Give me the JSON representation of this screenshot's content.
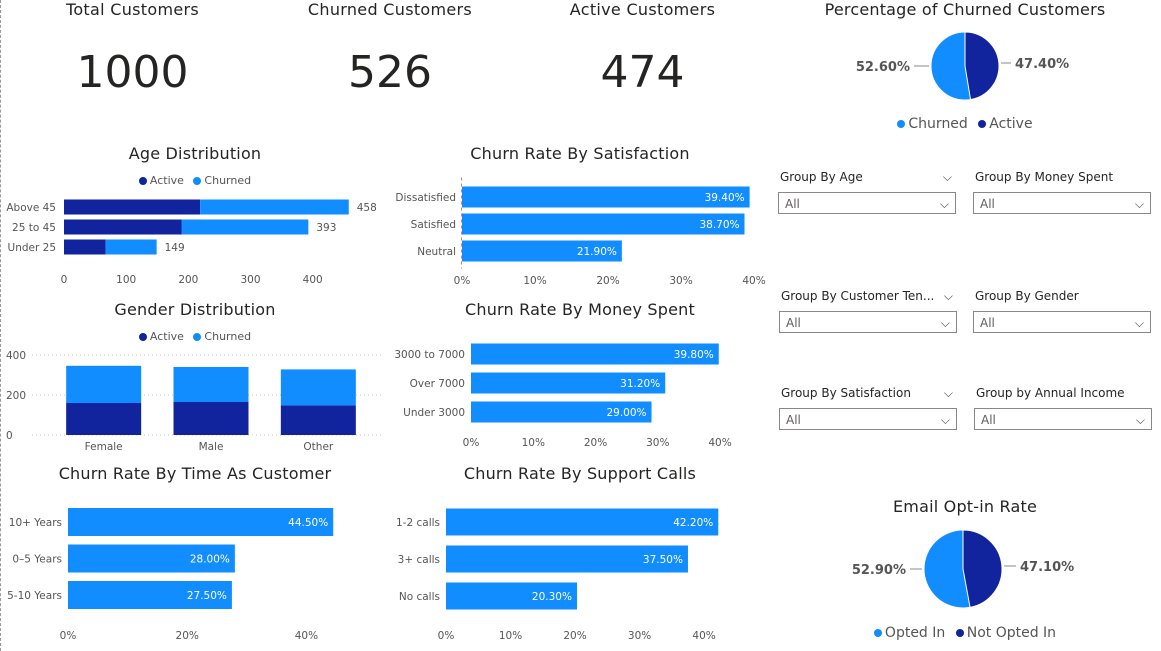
{
  "kpis": {
    "total": {
      "title": "Total Customers",
      "value": "1000"
    },
    "churned": {
      "title": "Churned Customers",
      "value": "526"
    },
    "active": {
      "title": "Active Customers",
      "value": "474"
    }
  },
  "colors": {
    "active": "#12239E",
    "churned": "#118DFF"
  },
  "slicers": [
    {
      "title": "Group By Age",
      "value": "All"
    },
    {
      "title": "Group By Money Spent",
      "value": "All"
    },
    {
      "title": "Group By Customer Ten...",
      "value": "All"
    },
    {
      "title": "Group By Gender",
      "value": "All"
    },
    {
      "title": "Group By Satisfaction",
      "value": "All"
    },
    {
      "title": "Group by Annual Income",
      "value": "All"
    }
  ],
  "icons": {
    "dropdown": "chevron-down-icon"
  },
  "chart_data": [
    {
      "id": "churn_pie",
      "type": "pie",
      "title": "Percentage of Churned Customers",
      "categories": [
        "Churned",
        "Active"
      ],
      "values": [
        52.6,
        47.4
      ],
      "labels": [
        "52.60%",
        "47.40%"
      ],
      "legend": [
        "Churned",
        "Active"
      ],
      "legend_position": "bottom"
    },
    {
      "id": "age",
      "type": "bar",
      "orientation": "horizontal",
      "stacked": true,
      "title": "Age Distribution",
      "legend": [
        "Active",
        "Churned"
      ],
      "legend_position": "top",
      "categories": [
        "Above 45",
        "25 to 45",
        "Under 25"
      ],
      "series": [
        {
          "name": "Active",
          "values": [
            219,
            189,
            67
          ]
        },
        {
          "name": "Churned",
          "values": [
            239,
            204,
            82
          ]
        }
      ],
      "totals": [
        "458",
        "393",
        "149"
      ],
      "xlim": [
        0,
        460
      ],
      "xticks": [
        "0",
        "100",
        "200",
        "300",
        "400"
      ],
      "xtick_values": [
        0,
        100,
        200,
        300,
        400
      ]
    },
    {
      "id": "gender",
      "type": "bar",
      "orientation": "vertical",
      "stacked": true,
      "title": "Gender Distribution",
      "legend": [
        "Active",
        "Churned"
      ],
      "legend_position": "top",
      "categories": [
        "Female",
        "Male",
        "Other"
      ],
      "series": [
        {
          "name": "Active",
          "values": [
            160,
            165,
            148
          ]
        },
        {
          "name": "Churned",
          "values": [
            186,
            175,
            180
          ]
        }
      ],
      "ylim": [
        0,
        420
      ],
      "yticks": [
        "0",
        "200",
        "400"
      ],
      "ytick_values": [
        0,
        200,
        400
      ],
      "grid": true
    },
    {
      "id": "time",
      "type": "bar",
      "orientation": "horizontal",
      "title": "Churn Rate By Time As Customer",
      "categories": [
        "10+ Years",
        "0–5 Years",
        "5-10 Years"
      ],
      "values": [
        44.5,
        28.0,
        27.5
      ],
      "labels": [
        "44.50%",
        "28.00%",
        "27.50%"
      ],
      "xlim": [
        0,
        50
      ],
      "xticks": [
        "0%",
        "20%",
        "40%"
      ],
      "xtick_values": [
        0,
        20,
        40
      ]
    },
    {
      "id": "satisfaction",
      "type": "bar",
      "orientation": "horizontal",
      "title": "Churn Rate By Satisfaction",
      "categories": [
        "Dissatisfied",
        "Satisfied",
        "Neutral"
      ],
      "values": [
        39.4,
        38.7,
        21.9
      ],
      "labels": [
        "39.40%",
        "38.70%",
        "21.90%"
      ],
      "xlim": [
        0,
        40
      ],
      "xticks": [
        "0%",
        "10%",
        "20%",
        "30%",
        "40%"
      ],
      "xtick_values": [
        0,
        10,
        20,
        30,
        40
      ]
    },
    {
      "id": "money",
      "type": "bar",
      "orientation": "horizontal",
      "title": "Churn Rate By Money Spent",
      "categories": [
        "3000 to 7000",
        "Over 7000",
        "Under 3000"
      ],
      "values": [
        39.8,
        31.2,
        29.0
      ],
      "labels": [
        "39.80%",
        "31.20%",
        "29.00%"
      ],
      "xlim": [
        0,
        40
      ],
      "xticks": [
        "0%",
        "10%",
        "20%",
        "30%",
        "40%"
      ],
      "xtick_values": [
        0,
        10,
        20,
        30,
        40
      ]
    },
    {
      "id": "support",
      "type": "bar",
      "orientation": "horizontal",
      "title": "Churn Rate By Support Calls",
      "categories": [
        "1-2 calls",
        "3+ calls",
        "No calls"
      ],
      "values": [
        42.2,
        37.5,
        20.3
      ],
      "labels": [
        "42.20%",
        "37.50%",
        "20.30%"
      ],
      "xlim": [
        0,
        42
      ],
      "xticks": [
        "0%",
        "10%",
        "20%",
        "30%",
        "40%"
      ],
      "xtick_values": [
        0,
        10,
        20,
        30,
        40
      ]
    },
    {
      "id": "email_pie",
      "type": "pie",
      "title": "Email Opt-in Rate",
      "categories": [
        "Opted In",
        "Not Opted In"
      ],
      "values": [
        52.9,
        47.1
      ],
      "labels": [
        "52.90%",
        "47.10%"
      ],
      "legend": [
        "Opted In",
        "Not Opted In"
      ],
      "legend_position": "bottom"
    }
  ]
}
